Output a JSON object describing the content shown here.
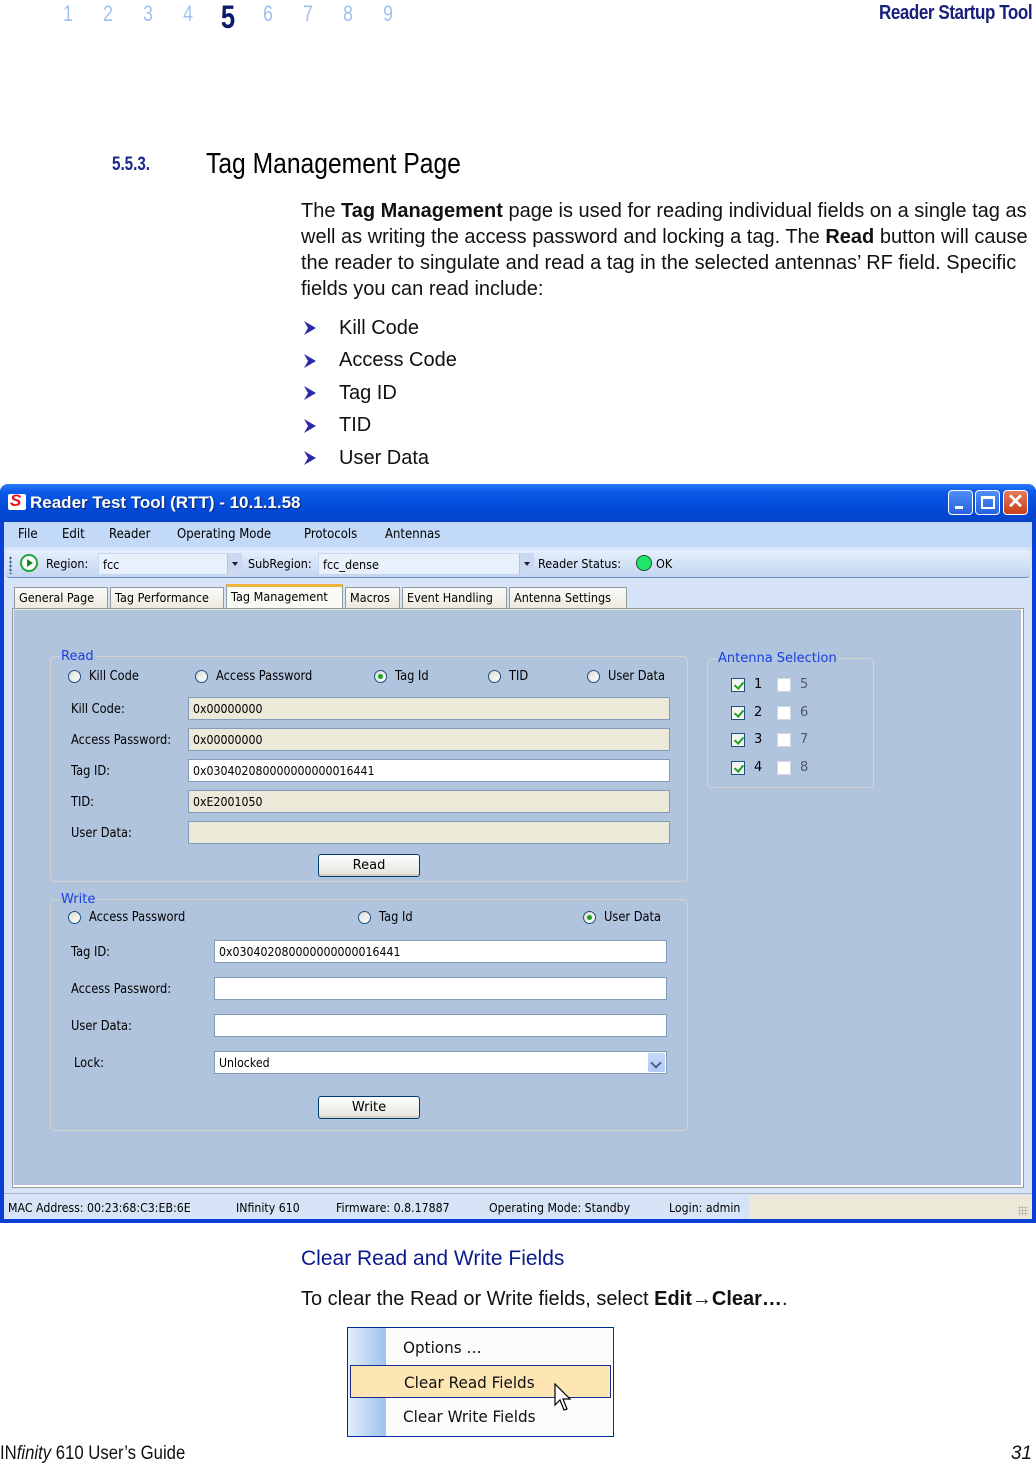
{
  "page_header": {
    "chapters": [
      "1",
      "2",
      "3",
      "4",
      "5",
      "6",
      "7",
      "8",
      "9"
    ],
    "current_chapter": "5",
    "running_title": "Reader Startup Tool"
  },
  "section": {
    "number": "5.5.3.",
    "title": "Tag Management Page",
    "intro": {
      "p1": "The ",
      "b1": "Tag Management",
      "p2": " page is used for reading individual fields on a single tag as well as writing the access password and locking a tag. The ",
      "b2": "Read",
      "p3": " button will cause the reader to singulate and read a tag in the selected antennas’ RF field. Specific fields you can read include:"
    },
    "bullets": [
      "Kill Code",
      "Access Code",
      "Tag ID",
      "TID",
      "User Data"
    ]
  },
  "app": {
    "window_title": "Reader Test Tool (RTT) - 10.1.1.58",
    "menu": [
      "File",
      "Edit",
      "Reader",
      "Operating Mode",
      "Protocols",
      "Antennas"
    ],
    "toolbar": {
      "region_label": "Region:",
      "region_value": "fcc",
      "subregion_label": "SubRegion:",
      "subregion_value": "fcc_dense",
      "status_label": "Reader Status:",
      "status_value": "OK",
      "status_color": "#22e66b"
    },
    "tabs": [
      "General Page",
      "Tag Performance",
      "Tag Management",
      "Macros",
      "Event Handling",
      "Antenna Settings"
    ],
    "active_tab": "Tag Management",
    "read": {
      "legend": "Read",
      "radios": [
        {
          "label": "Kill Code",
          "selected": false
        },
        {
          "label": "Access Password",
          "selected": false
        },
        {
          "label": "Tag Id",
          "selected": true
        },
        {
          "label": "TID",
          "selected": false
        },
        {
          "label": "User Data",
          "selected": false
        }
      ],
      "fields": [
        {
          "label": "Kill Code:",
          "value": "0x00000000",
          "editable": false
        },
        {
          "label": "Access Password:",
          "value": "0x00000000",
          "editable": false
        },
        {
          "label": "Tag ID:",
          "value": "0x030402080000000000016441",
          "editable": true
        },
        {
          "label": "TID:",
          "value": "0xE2001050",
          "editable": false
        },
        {
          "label": "User Data:",
          "value": "",
          "editable": false
        }
      ],
      "button": "Read"
    },
    "write": {
      "legend": "Write",
      "radios": [
        {
          "label": "Access Password",
          "selected": false
        },
        {
          "label": "Tag Id",
          "selected": false
        },
        {
          "label": "User Data",
          "selected": true
        }
      ],
      "fields": [
        {
          "label": "Tag ID:",
          "value": "0x030402080000000000016441"
        },
        {
          "label": "Access Password:",
          "value": ""
        },
        {
          "label": "User Data:",
          "value": ""
        }
      ],
      "lock_label": "Lock:",
      "lock_value": "Unlocked",
      "button": "Write"
    },
    "antenna_selection": {
      "legend": "Antenna Selection",
      "antennas": [
        {
          "label": "1",
          "checked": true,
          "enabled": true
        },
        {
          "label": "2",
          "checked": true,
          "enabled": true
        },
        {
          "label": "3",
          "checked": true,
          "enabled": true
        },
        {
          "label": "4",
          "checked": true,
          "enabled": true
        },
        {
          "label": "5",
          "checked": false,
          "enabled": false
        },
        {
          "label": "6",
          "checked": false,
          "enabled": false
        },
        {
          "label": "7",
          "checked": false,
          "enabled": false
        },
        {
          "label": "8",
          "checked": false,
          "enabled": false
        }
      ]
    },
    "statusbar": {
      "mac": "MAC Address: 00:23:68:C3:EB:6E",
      "device": "INfinity 610",
      "firmware": "Firmware: 0.8.17887",
      "mode": "Operating Mode: Standby",
      "login": "Login: admin"
    }
  },
  "clear_section": {
    "heading": "Clear Read and Write Fields",
    "text_prefix": "To clear the Read or Write fields, select ",
    "text_bold": "Edit→Clear…",
    "text_suffix": ".",
    "menu_items": [
      "Options …",
      "Clear Read Fields",
      "Clear Write Fields"
    ],
    "highlighted_item": "Clear Read Fields"
  },
  "footer": {
    "guide_prefix": "IN",
    "guide_italic": "finity",
    "guide_suffix": " 610 User’s Guide",
    "page_number": "31"
  }
}
